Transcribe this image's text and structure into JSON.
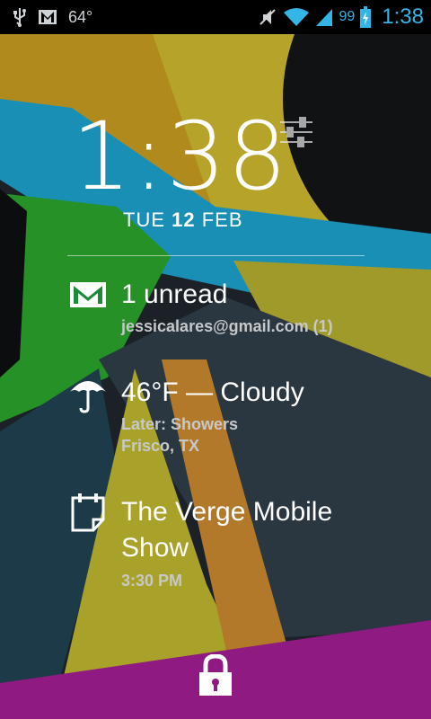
{
  "statusbar": {
    "temperature": "64°",
    "battery_percent": "99",
    "time": "1:38",
    "accent_color": "#33b5e5",
    "left_icons": [
      "usb-icon",
      "gmail-icon"
    ],
    "right_icons": [
      "muted-icon",
      "wifi-icon",
      "signal-icon",
      "battery-charging-icon"
    ]
  },
  "lockscreen": {
    "clock": "1:38",
    "date_day": "TUE",
    "date_num": "12",
    "date_month": "FEB",
    "settings_icon": "settings-sliders-icon",
    "lock_icon": "lock-icon"
  },
  "notifications": [
    {
      "icon": "gmail-icon",
      "primary": "1 unread",
      "secondary": "jessicalares@gmail.com (1)"
    },
    {
      "icon": "umbrella-icon",
      "primary": "46°F — Cloudy",
      "secondary_line1": "Later: Showers",
      "secondary_line2": "Frisco, TX"
    },
    {
      "icon": "calendar-icon",
      "primary_line1": "The Verge Mobile",
      "primary_line2": "Show",
      "secondary": "3:30 PM"
    }
  ]
}
